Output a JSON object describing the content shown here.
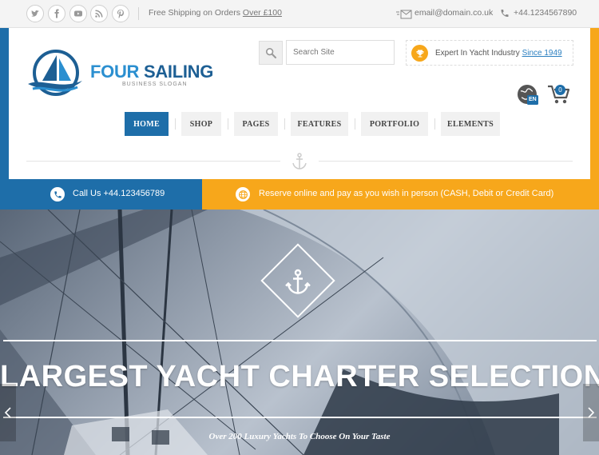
{
  "topbar": {
    "social_icons": [
      "twitter-icon",
      "facebook-icon",
      "youtube-icon",
      "rss-icon",
      "pinterest-icon"
    ],
    "shipping_text": "Free Shipping on Orders",
    "shipping_link": "Over £100",
    "email": "email@domain.co.uk",
    "phone": "+44.1234567890"
  },
  "header": {
    "brand_part1": "FOUR",
    "brand_part2": "SAILING",
    "slogan": "BUSINESS SLOGAN",
    "search_placeholder": "Search Site",
    "expert_text": "Expert In Yacht Industry",
    "expert_link": "Since 1949",
    "language": "EN",
    "cart_count": "0"
  },
  "nav": {
    "items": [
      {
        "label": "HOME",
        "active": true
      },
      {
        "label": "SHOP",
        "active": false
      },
      {
        "label": "PAGES",
        "active": false
      },
      {
        "label": "FEATURES",
        "active": false
      },
      {
        "label": "PORTFOLIO",
        "active": false
      },
      {
        "label": "ELEMENTS",
        "active": false
      }
    ]
  },
  "infobar": {
    "call_text": "Call Us +44.123456789",
    "reserve_text": "Reserve online and pay as you wish in person (CASH, Debit or Credit Card)"
  },
  "hero": {
    "headline": "LARGEST YACHT CHARTER SELECTION",
    "subline": "Over 200 Luxury Yachts To Choose On Your Taste"
  },
  "colors": {
    "blue": "#1e6ea9",
    "orange": "#f7a71b",
    "brand_light": "#2b8fd0"
  }
}
